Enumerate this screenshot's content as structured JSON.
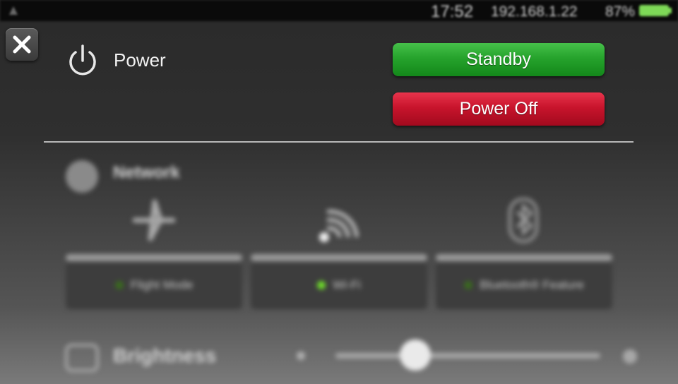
{
  "status_bar": {
    "time": "17:52",
    "ip_address": "192.168.1.22",
    "battery_percent": "87%",
    "battery_color": "#7ed957"
  },
  "close_button": {
    "icon": "close-icon"
  },
  "power": {
    "title": "Power",
    "icon": "power-icon",
    "standby_label": "Standby",
    "standby_color": "#26a32c",
    "power_off_label": "Power Off",
    "power_off_color": "#c8142c"
  },
  "network": {
    "title": "Network",
    "icon": "globe-icon",
    "tiles": [
      {
        "label": "Flight Mode",
        "icon": "airplane-icon",
        "led_color": "#3a6a1e"
      },
      {
        "label": "Wi-Fi",
        "icon": "wifi-icon",
        "led_color": "#6fe02a"
      },
      {
        "label": "Bluetooth® Feature",
        "icon": "bluetooth-icon",
        "led_color": "#3a6a1e"
      }
    ]
  },
  "brightness": {
    "title": "Brightness",
    "icon": "brightness-icon",
    "level": 0.3
  }
}
